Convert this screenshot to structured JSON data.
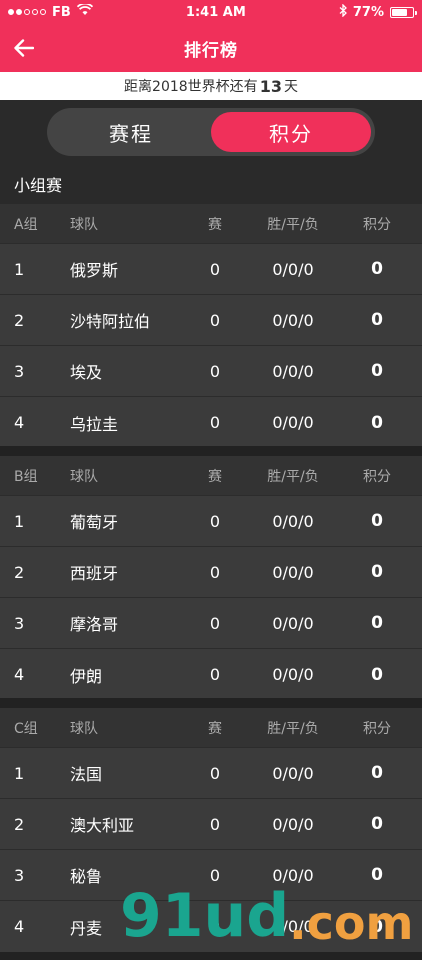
{
  "status": {
    "carrier": "FB",
    "time": "1:41 AM",
    "battery": "77%",
    "battery_level": 0.77
  },
  "nav": {
    "title": "排行榜"
  },
  "countdown": {
    "prefix": "距离2018世界杯还有",
    "days": "13",
    "suffix": "天"
  },
  "tabs": [
    {
      "label": "赛程",
      "active": false
    },
    {
      "label": "积分",
      "active": true
    }
  ],
  "section": {
    "title": "小组赛"
  },
  "groups": [
    {
      "name": "A组",
      "headers": {
        "team": "球队",
        "games": "赛",
        "wdl": "胜/平/负",
        "pts": "积分"
      },
      "rows": [
        {
          "rank": "1",
          "team": "俄罗斯",
          "games": "0",
          "wdl": "0/0/0",
          "pts": "0"
        },
        {
          "rank": "2",
          "team": "沙特阿拉伯",
          "games": "0",
          "wdl": "0/0/0",
          "pts": "0"
        },
        {
          "rank": "3",
          "team": "埃及",
          "games": "0",
          "wdl": "0/0/0",
          "pts": "0"
        },
        {
          "rank": "4",
          "team": "乌拉圭",
          "games": "0",
          "wdl": "0/0/0",
          "pts": "0"
        }
      ]
    },
    {
      "name": "B组",
      "headers": {
        "team": "球队",
        "games": "赛",
        "wdl": "胜/平/负",
        "pts": "积分"
      },
      "rows": [
        {
          "rank": "1",
          "team": "葡萄牙",
          "games": "0",
          "wdl": "0/0/0",
          "pts": "0"
        },
        {
          "rank": "2",
          "team": "西班牙",
          "games": "0",
          "wdl": "0/0/0",
          "pts": "0"
        },
        {
          "rank": "3",
          "team": "摩洛哥",
          "games": "0",
          "wdl": "0/0/0",
          "pts": "0"
        },
        {
          "rank": "4",
          "team": "伊朗",
          "games": "0",
          "wdl": "0/0/0",
          "pts": "0"
        }
      ]
    },
    {
      "name": "C组",
      "headers": {
        "team": "球队",
        "games": "赛",
        "wdl": "胜/平/负",
        "pts": "积分"
      },
      "rows": [
        {
          "rank": "1",
          "team": "法国",
          "games": "0",
          "wdl": "0/0/0",
          "pts": "0"
        },
        {
          "rank": "2",
          "team": "澳大利亚",
          "games": "0",
          "wdl": "0/0/0",
          "pts": "0"
        },
        {
          "rank": "3",
          "team": "秘鲁",
          "games": "0",
          "wdl": "0/0/0",
          "pts": "0"
        },
        {
          "rank": "4",
          "team": "丹麦",
          "games": "0",
          "wdl": "0/0/0",
          "pts": "0"
        }
      ]
    }
  ],
  "watermark": {
    "part1": "91ud",
    "part2": ".com"
  },
  "colors": {
    "accent": "#f0305a",
    "watermark_green": "#1aa58f",
    "watermark_orange": "#f0a040"
  },
  "icons": {
    "back": "back-arrow-icon",
    "wifi": "wifi-icon",
    "bluetooth": "bluetooth-icon",
    "battery": "battery-icon"
  }
}
